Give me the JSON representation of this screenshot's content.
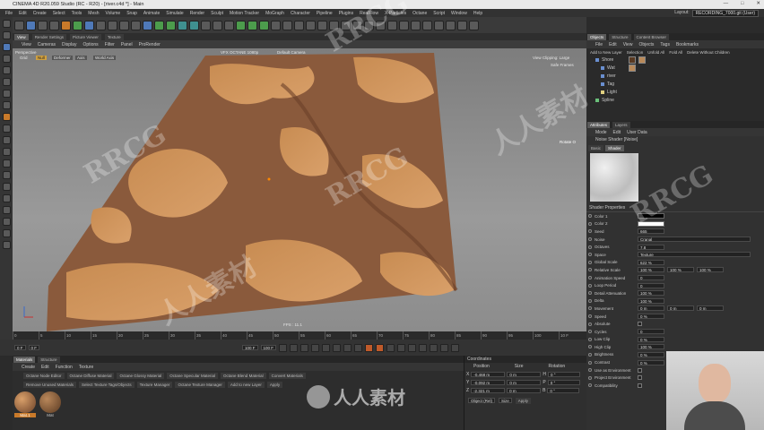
{
  "window": {
    "title": "CINEMA 4D R20.059 Studio (RC - R20) - [river.c4d *] - Main"
  },
  "menu": [
    "File",
    "Edit",
    "Create",
    "Select",
    "Tools",
    "Mesh",
    "Volume",
    "Snap",
    "Animate",
    "Simulate",
    "Render",
    "Sculpt",
    "Motion Tracker",
    "MoGraph",
    "Character",
    "Pipeline",
    "Plugins",
    "RealFlow",
    "X-Particles",
    "Octane",
    "Script",
    "Window",
    "Help"
  ],
  "layout": {
    "label": "Layout:",
    "value": "RECORDING_7000.git (User)"
  },
  "view_tabs": [
    "View",
    "Render Settings",
    "Picture Viewer",
    "Texture"
  ],
  "view_menu": [
    "View",
    "Cameras",
    "Display",
    "Options",
    "Filter",
    "Panel",
    "ProRender"
  ],
  "viewport": {
    "mode": "Perspective",
    "grid": "Grid",
    "null": "Null",
    "deformer": "Deformer",
    "axis": "Axis",
    "world_axis": "World Axis",
    "octane_label": "VFX OCTANE 1080p",
    "camera": "Default Camera",
    "clipping": "View Clipping: Large",
    "safe_frames": "Safe Frames",
    "rotate": "Rotate O",
    "fps": "FPS : 11.1"
  },
  "timeline": {
    "ticks": [
      "0",
      "5",
      "10",
      "15",
      "20",
      "25",
      "30",
      "35",
      "40",
      "45",
      "50",
      "55",
      "60",
      "65",
      "70",
      "75",
      "80",
      "85",
      "90",
      "95",
      "100",
      "10 F"
    ],
    "current": "0 F",
    "start": "0 F",
    "end": "100 F",
    "end2": "100 F",
    "frame_label": "0 F"
  },
  "materials": {
    "tabs": [
      "Materials",
      "Structure"
    ],
    "menu": [
      "Create",
      "Edit",
      "Function",
      "Texture"
    ],
    "buttons": [
      "Octane Node Editor",
      "Octane Diffuse Material",
      "Octane Glossy Material",
      "Octane Specular Material",
      "Octane Blend Material",
      "Convert Materials",
      "Remove Unused Materials",
      "Select Texture Tags/Objects",
      "Texture Manager",
      "Octane Texture Manager",
      "Add to new Layer",
      "Apply"
    ],
    "items": [
      "Mat.1",
      "Mat"
    ]
  },
  "coords": {
    "title": "Coordinates",
    "headers": [
      "Position",
      "Size",
      "Rotation"
    ],
    "rows": [
      {
        "axis": "X",
        "pos": "-0.468 m",
        "size": "0 m",
        "rot_axis": "H",
        "rot": "0 °"
      },
      {
        "axis": "Y",
        "pos": "-0.092 m",
        "size": "0 m",
        "rot_axis": "P",
        "rot": "0 °"
      },
      {
        "axis": "Z",
        "pos": "-2.321 m",
        "size": "0 m",
        "rot_axis": "B",
        "rot": "0 °"
      }
    ],
    "mode": "Object (Rel)",
    "size_mode": "Size",
    "apply": "Apply"
  },
  "objects": {
    "tabs": [
      "Objects",
      "Structure",
      "Content Browser"
    ],
    "menu": [
      "File",
      "Edit",
      "View",
      "Objects",
      "Tags",
      "Bookmarks"
    ],
    "toolbar": [
      "Add to New Layer",
      "Selection",
      "Unfold All",
      "Fold All",
      "Delete Without Children"
    ],
    "items": [
      "Shore",
      "Wat",
      "river",
      "Tag",
      "Light",
      "Spline"
    ]
  },
  "attributes": {
    "tabs": [
      "Attributes",
      "Layers"
    ],
    "menu": [
      "Mode",
      "Edit",
      "User Data"
    ],
    "title": "Noise Shader [Noise]",
    "subtabs": [
      "Basic",
      "Shader"
    ],
    "section": "Shader Properties",
    "props": [
      {
        "label": "Color 1",
        "value": "",
        "swatch": "#000000"
      },
      {
        "label": "Color 2",
        "value": "",
        "swatch": "#ffffff"
      },
      {
        "label": "Seed",
        "value": "665"
      },
      {
        "label": "Noise",
        "value": "Cranal"
      },
      {
        "label": "Octaves",
        "value": "7.8"
      },
      {
        "label": "Space",
        "value": "Texture"
      },
      {
        "label": "Global Scale",
        "value": "622 %"
      },
      {
        "label": "Relative Scale",
        "value": "100 %",
        "v2": "100 %",
        "v3": "100 %"
      },
      {
        "label": "Animation Speed",
        "value": "0"
      },
      {
        "label": "Loop Period",
        "value": "0"
      },
      {
        "label": "Detail Attenuation",
        "value": "100 %"
      },
      {
        "label": "Delta",
        "value": "100 %"
      },
      {
        "label": "Movement",
        "value": "0 m",
        "v2": "0 m",
        "v3": "0 m"
      },
      {
        "label": "Speed",
        "value": "0 %"
      },
      {
        "label": "Absolute",
        "value": ""
      },
      {
        "label": "Cycles",
        "value": "0"
      },
      {
        "label": "Low Clip",
        "value": "0 %"
      },
      {
        "label": "High Clip",
        "value": "100 %"
      },
      {
        "label": "Brightness",
        "value": "0 %"
      },
      {
        "label": "Contrast",
        "value": "0 %"
      },
      {
        "label": "Use as Environment",
        "value": ""
      },
      {
        "label": "Project Environment",
        "value": ""
      },
      {
        "label": "Compatibility",
        "value": ""
      }
    ]
  },
  "watermarks": [
    "RRCG",
    "人人素材",
    "RRCG",
    "人人素材",
    "RRCG",
    "RRCG"
  ],
  "bottom_logo": "人人素材"
}
